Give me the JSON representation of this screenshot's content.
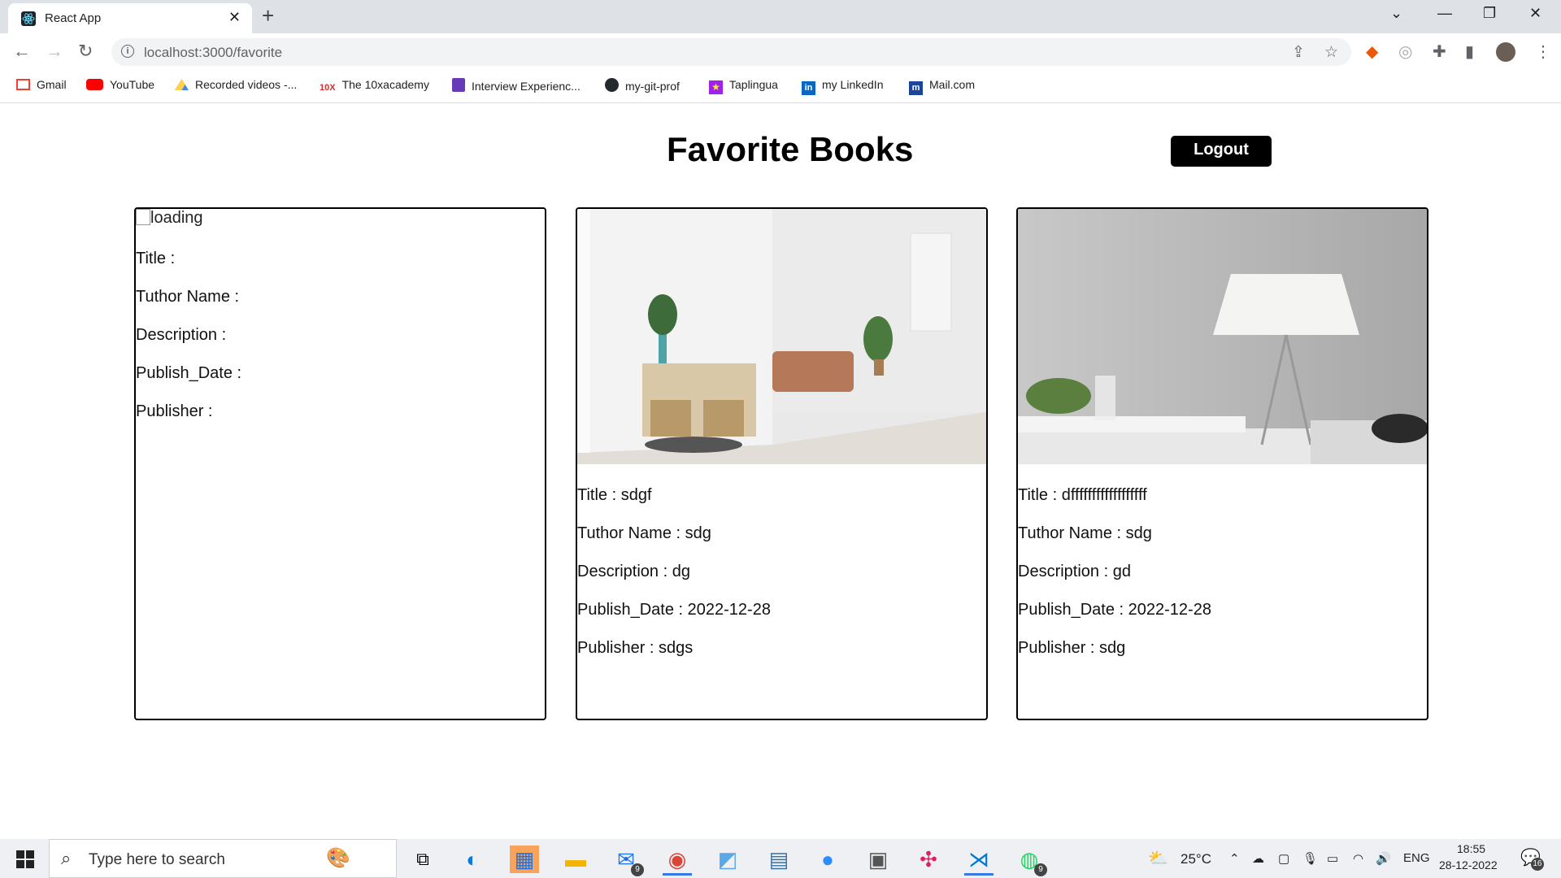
{
  "browser": {
    "tab_title": "React App",
    "url": "localhost:3000/favorite",
    "bookmarks": [
      {
        "label": "Gmail",
        "icon": "gmail-icon",
        "color": "#ea4335"
      },
      {
        "label": "YouTube",
        "icon": "youtube-icon",
        "color": "#ff0000"
      },
      {
        "label": "Recorded videos -...",
        "icon": "google-drive-icon",
        "color": "#1fa463"
      },
      {
        "label": "The 10xacademy",
        "icon": "tenx-icon",
        "color": "#d32f2f"
      },
      {
        "label": "Interview Experienc...",
        "icon": "form-icon",
        "color": "#673ab7"
      },
      {
        "label": "my-git-prof",
        "icon": "github-icon",
        "color": "#24292e"
      },
      {
        "label": "Taplingua",
        "icon": "star-icon",
        "color": "#a020f0"
      },
      {
        "label": "my LinkedIn",
        "icon": "linkedin-icon",
        "color": "#0a66c2"
      },
      {
        "label": "Mail.com",
        "icon": "mailcom-icon",
        "color": "#1c449b"
      }
    ]
  },
  "page": {
    "title": "Favorite Books",
    "logout_label": "Logout"
  },
  "books": [
    {
      "image": "broken",
      "alt": "loading",
      "title": "Title : ",
      "author": "Tuthor Name : ",
      "description": "Description : ",
      "publish_date": "Publish_Date : ",
      "publisher": "Publisher : "
    },
    {
      "image": "living-room",
      "title": "Title : sdgf",
      "author": "Tuthor Name : sdg",
      "description": "Description : dg",
      "publish_date": "Publish_Date : 2022-12-28",
      "publisher": "Publisher : sdgs"
    },
    {
      "image": "lamp-room",
      "title": "Title : dffffffffffffffffff",
      "author": "Tuthor Name : sdg",
      "description": "Description : gd",
      "publish_date": "Publish_Date : 2022-12-28",
      "publisher": "Publisher : sdg"
    }
  ],
  "taskbar": {
    "search_placeholder": "Type here to search",
    "mail_badge": "9",
    "whatsapp_badge": "9",
    "weather": "25°C",
    "language": "ENG",
    "time": "18:55",
    "date": "28-12-2022",
    "notification_count": "16"
  }
}
